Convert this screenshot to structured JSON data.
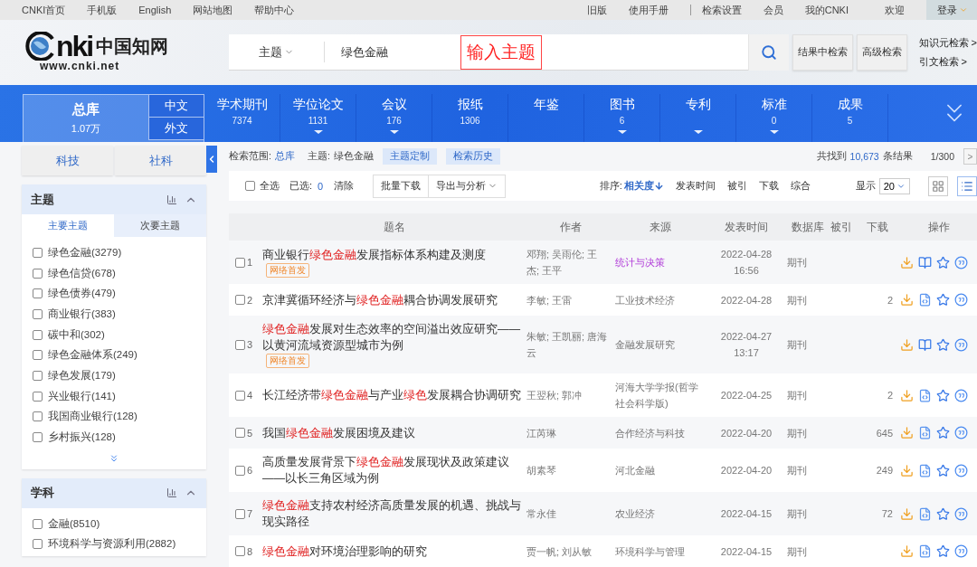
{
  "top_bar": {
    "left_links": [
      "CNKI首页",
      "手机版",
      "English",
      "网站地图",
      "帮助中心"
    ],
    "right_links": [
      "旧版",
      "使用手册",
      "检索设置",
      "会员",
      "我的CNKI"
    ],
    "welcome": "欢迎",
    "login": "登录"
  },
  "logo": {
    "mark": "nki",
    "name": "中国知网",
    "url": "www.cnki.net"
  },
  "search": {
    "field": "主题",
    "value": "绿色金融",
    "annotation": "输入主题",
    "buttons": [
      "结果中检索",
      "高级检索"
    ],
    "links": [
      "知识元检索 >",
      "引文检索 >"
    ]
  },
  "databases": {
    "all": {
      "label": "总库",
      "count": "1.07万",
      "selected": true
    },
    "languages": [
      {
        "label": "中文"
      },
      {
        "label": "外文"
      }
    ],
    "items": [
      {
        "label": "学术期刊",
        "count": "7374",
        "expandable": false
      },
      {
        "label": "学位论文",
        "count": "1131",
        "expandable": true
      },
      {
        "label": "会议",
        "count": "176",
        "expandable": true
      },
      {
        "label": "报纸",
        "count": "1306",
        "expandable": false
      },
      {
        "label": "年鉴",
        "expandable": false
      },
      {
        "label": "图书",
        "count": "6",
        "expandable": true
      },
      {
        "label": "专利",
        "expandable": true
      },
      {
        "label": "标准",
        "count": "0",
        "expandable": true
      },
      {
        "label": "成果",
        "count": "5",
        "expandable": false
      }
    ]
  },
  "sidebar": {
    "categories": [
      {
        "label": "科技",
        "selected": false
      },
      {
        "label": "社科",
        "selected": false
      }
    ],
    "groups": [
      {
        "title": "主题",
        "tabs": [
          {
            "label": "主要主题",
            "selected": true
          },
          {
            "label": "次要主题",
            "selected": false
          }
        ],
        "items": [
          {
            "label": "绿色金融(3279)",
            "checked": false
          },
          {
            "label": "绿色信贷(678)",
            "checked": false
          },
          {
            "label": "绿色债券(479)",
            "checked": false
          },
          {
            "label": "商业银行(383)",
            "checked": false
          },
          {
            "label": "碳中和(302)",
            "checked": false
          },
          {
            "label": "绿色金融体系(249)",
            "checked": false
          },
          {
            "label": "绿色发展(179)",
            "checked": false
          },
          {
            "label": "兴业银行(141)",
            "checked": false
          },
          {
            "label": "我国商业银行(128)",
            "checked": false
          },
          {
            "label": "乡村振兴(128)",
            "checked": false
          }
        ],
        "more": true
      },
      {
        "title": "学科",
        "items": [
          {
            "label": "金融(8510)",
            "checked": false
          },
          {
            "label": "环境科学与资源利用(2882)",
            "checked": false
          }
        ],
        "more": false
      }
    ]
  },
  "results": {
    "scope_label": "检索范围:",
    "scope": "总库",
    "query_label": "主题:",
    "query": "绿色金融",
    "tag_buttons": [
      "主题定制",
      "检索历史"
    ],
    "found_prefix": "共找到",
    "found": "10,673",
    "found_suffix": "条结果",
    "page": "1/300",
    "next": ">",
    "select_all": {
      "label": "全选",
      "checked": false
    },
    "selected_label": "已选:",
    "selected_count": "0",
    "clear": "清除",
    "actions": [
      {
        "label": "批量下载",
        "dropdown": false
      },
      {
        "label": "导出与分析",
        "dropdown": true
      }
    ],
    "sort_label": "排序:",
    "sorts": [
      {
        "label": "相关度",
        "selected": true
      },
      {
        "label": "发表时间",
        "selected": false
      },
      {
        "label": "被引",
        "selected": false
      },
      {
        "label": "下载",
        "selected": false
      },
      {
        "label": "综合",
        "selected": false
      }
    ],
    "page_size_label": "显示",
    "page_size": "20",
    "views": [
      {
        "kind": "grid",
        "selected": false
      },
      {
        "kind": "list",
        "selected": true
      }
    ]
  },
  "table": {
    "columns": [
      "题名",
      "作者",
      "来源",
      "发表时间",
      "数据库",
      "被引",
      "下载",
      "操作"
    ],
    "rows": [
      {
        "number": "1",
        "checked": false,
        "title": [
          {
            "text": "商业银行",
            "hit": false
          },
          {
            "text": "绿色金融",
            "hit": true
          },
          {
            "text": "发展指标体系构建及测度",
            "hit": false
          }
        ],
        "badge": "网络首发",
        "authors": "邓翔; 吴雨伦; 王杰; 王平",
        "source": "统计与决策",
        "visited": true,
        "date": "2022-04-28 16:56",
        "database": "期刊",
        "kind": "book"
      },
      {
        "number": "2",
        "checked": false,
        "title": [
          {
            "text": "京津冀循环经济与",
            "hit": false
          },
          {
            "text": "绿色金融",
            "hit": true
          },
          {
            "text": "耦合协调发展研究",
            "hit": false
          }
        ],
        "authors": "李敏; 王雷",
        "source": "工业技术经济",
        "visited": false,
        "date": "2022-04-28",
        "database": "期刊",
        "downloads": "2",
        "kind": "html"
      },
      {
        "number": "3",
        "checked": false,
        "title": [
          {
            "text": "绿色金融",
            "hit": true
          },
          {
            "text": "发展对生态效率的空间溢出效应研究——以黄河流域资源型城市为例",
            "hit": false
          }
        ],
        "badge": "网络首发",
        "authors": "朱敏; 王凯丽; 唐海云",
        "source": "金融发展研究",
        "visited": false,
        "date": "2022-04-27 13:17",
        "database": "期刊",
        "kind": "book"
      },
      {
        "number": "4",
        "checked": false,
        "title": [
          {
            "text": "长江经济带",
            "hit": false
          },
          {
            "text": "绿色金融",
            "hit": true
          },
          {
            "text": "与产业",
            "hit": false
          },
          {
            "text": "绿色",
            "hit": true
          },
          {
            "text": "发展耦合协调研究",
            "hit": false
          }
        ],
        "authors": "王翌秋; 郭冲",
        "source": "河海大学学报(哲学社会科学版)",
        "visited": false,
        "date": "2022-04-25",
        "database": "期刊",
        "downloads": "2",
        "kind": "html"
      },
      {
        "number": "5",
        "checked": false,
        "title": [
          {
            "text": "我国",
            "hit": false
          },
          {
            "text": "绿色金融",
            "hit": true
          },
          {
            "text": "发展困境及建议",
            "hit": false
          }
        ],
        "authors": "江芮琳",
        "source": "合作经济与科技",
        "visited": false,
        "date": "2022-04-20",
        "database": "期刊",
        "downloads": "645",
        "kind": "html"
      },
      {
        "number": "6",
        "checked": false,
        "title": [
          {
            "text": "高质量发展背景下",
            "hit": false
          },
          {
            "text": "绿色金融",
            "hit": true
          },
          {
            "text": "发展现状及政策建议——以长三角区域为例",
            "hit": false
          }
        ],
        "authors": "胡素琴",
        "source": "河北金融",
        "visited": false,
        "date": "2022-04-20",
        "database": "期刊",
        "downloads": "249",
        "kind": "html"
      },
      {
        "number": "7",
        "checked": false,
        "title": [
          {
            "text": "绿色金融",
            "hit": true
          },
          {
            "text": "支持农村经济高质量发展的机遇、挑战与现实路径",
            "hit": false
          }
        ],
        "authors": "常永佳",
        "source": "农业经济",
        "visited": false,
        "date": "2022-04-15",
        "database": "期刊",
        "downloads": "72",
        "kind": "html"
      },
      {
        "number": "8",
        "checked": false,
        "title": [
          {
            "text": "绿色金融",
            "hit": true
          },
          {
            "text": "对环境治理影响的研究",
            "hit": false
          }
        ],
        "authors": "贾一帆; 刘从敏",
        "source": "环境科学与管理",
        "visited": false,
        "date": "2022-04-15",
        "database": "期刊",
        "kind": "html"
      }
    ]
  }
}
